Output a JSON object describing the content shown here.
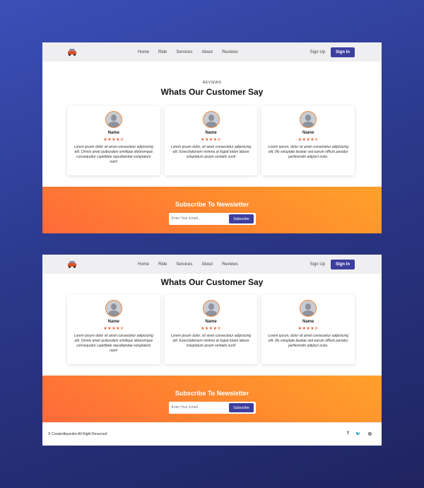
{
  "nav": {
    "menu": [
      "Home",
      "Ride",
      "Services",
      "About",
      "Reviews"
    ],
    "signup": "Sign Up",
    "signin": "Sign In"
  },
  "reviews": {
    "eyebrow": "REVIEWS",
    "heading": "Whats Our Customer Say",
    "cards": [
      {
        "name": "Name",
        "stars": "★★★★✮",
        "text": "Lorem ipsum dolor sit amet consectetur adipisicing elit. Omnis amet quibusdam similique doloremque consequatur cupiditate repudiandae voluptatum nam!"
      },
      {
        "name": "Name",
        "stars": "★★★★✮",
        "text": "Lorem ipsum dolor, sit amet consectetur adipisicing elit. Exercitationem minima at fugiat totam labore voluptatum ipsum veritatis sunt!"
      },
      {
        "name": "Name",
        "stars": "★★★★✮",
        "text": "Lorem ipsum, dolor sit amet consectetur adipisicing elit. Illo voluptate beatae sed earum officiis pariatur perferendis adipisci iusto."
      }
    ]
  },
  "newsletter": {
    "title": "Subscribe To Newsletter",
    "placeholder": "Enter Your Email...",
    "button": "Subscribe"
  },
  "footer": {
    "copyright": "© Createdbyandre All Right Reserved",
    "social": [
      "f",
      "🐦",
      "◎"
    ]
  }
}
